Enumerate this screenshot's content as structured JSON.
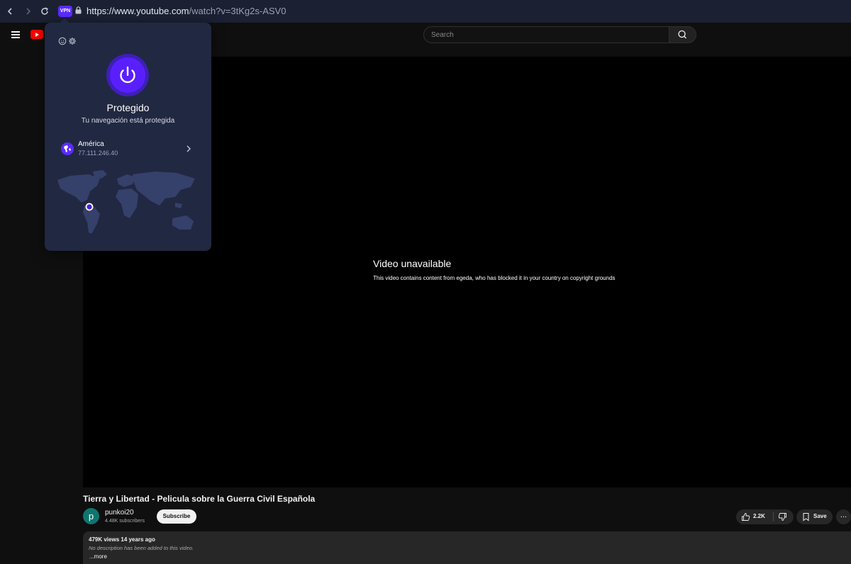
{
  "browser": {
    "url_domain": "https://www.youtube.com",
    "url_path": "/watch?v=3tKg2s-ASV0",
    "vpn_badge": "VPN"
  },
  "header": {
    "search_placeholder": "Search"
  },
  "player": {
    "error_title": "Video unavailable",
    "error_message": "This video contains content from egeda, who has blocked it in your country on copyright grounds"
  },
  "video": {
    "title": "Tierra y Libertad - Pelicula sobre la Guerra Civil Española",
    "channel_initial": "p",
    "channel_name": "punkoi20",
    "subscribers": "4.48K subscribers",
    "subscribe_label": "Subscribe",
    "likes": "2.2K",
    "save_label": "Save",
    "more_label": "..."
  },
  "description": {
    "stats": "479K views  14 years ago",
    "text": "No description has been added to this video.",
    "more_label": "...more"
  },
  "vpn_popup": {
    "status_title": "Protegido",
    "status_subtitle": "Tu navegación está protegida",
    "location_name": "América",
    "location_ip": "77.111.246.40"
  },
  "colors": {
    "vpn_accent": "#5a1fff",
    "youtube_red": "#ff0000",
    "popup_bg": "#212841"
  }
}
